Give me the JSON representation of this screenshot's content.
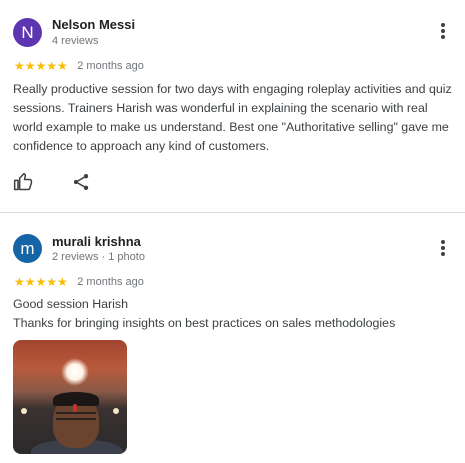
{
  "colors": {
    "star": "#fbbc04",
    "avatar_1": "#5e35b1",
    "avatar_2": "#1565a6",
    "divider": "#dadce0",
    "meta": "#70757a"
  },
  "icons": {
    "menu": "more-vert-icon",
    "like": "thumb-up-icon",
    "share": "share-icon",
    "star": "star-icon"
  },
  "reviews": [
    {
      "initial": "N",
      "name": "Nelson Messi",
      "meta": "4 reviews",
      "rating": 5,
      "stars": "★★★★★",
      "time_ago": "2 months ago",
      "text": "Really productive session for two days with engaging roleplay activities and quiz sessions. Trainers Harish was wonderful in explaining the scenario with real world example to make us understand. Best one \"Authoritative selling\" gave me confidence to approach any kind of customers."
    },
    {
      "initial": "m",
      "name": "murali krishna",
      "meta": "2 reviews · 1 photo",
      "rating": 5,
      "stars": "★★★★★",
      "time_ago": "2 months ago",
      "text": "Good session Harish\nThanks for bringing insights on best practices on sales methodologies"
    }
  ]
}
